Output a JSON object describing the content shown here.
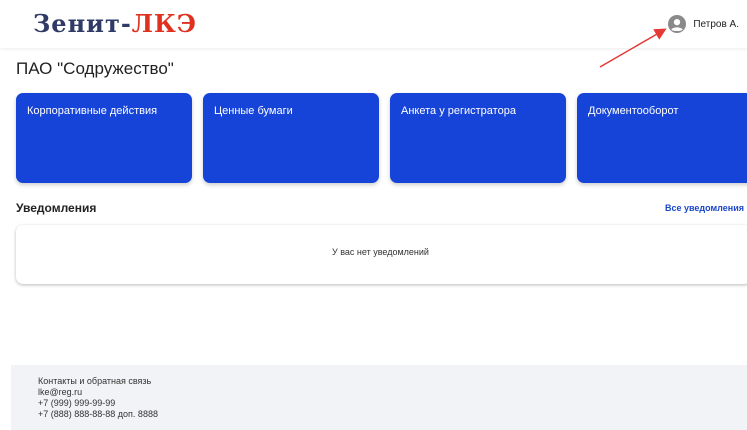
{
  "header": {
    "logo_part1": "Зенит-",
    "logo_part2": "ЛКЭ",
    "user_name": "Петров А."
  },
  "company": {
    "title": "ПАО \"Содружество\""
  },
  "cards": [
    {
      "label": "Корпоративные действия"
    },
    {
      "label": "Ценные бумаги"
    },
    {
      "label": "Анкета у регистратора"
    },
    {
      "label": "Документооборот"
    }
  ],
  "notifications": {
    "title": "Уведомления",
    "all_link": "Все уведомления",
    "empty_text": "У вас нет уведомлений"
  },
  "footer": {
    "heading": "Контакты и обратная связь",
    "email": "lke@reg.ru",
    "phone1": "+7 (999) 999-99-99",
    "phone2": "+7 (888) 888-88-88 доп. 8888"
  },
  "colors": {
    "card_bg": "#1744d8",
    "logo_dark": "#2f3b66",
    "logo_accent": "#e0301e",
    "link": "#1a47c9",
    "annotation_arrow": "#e53935"
  }
}
